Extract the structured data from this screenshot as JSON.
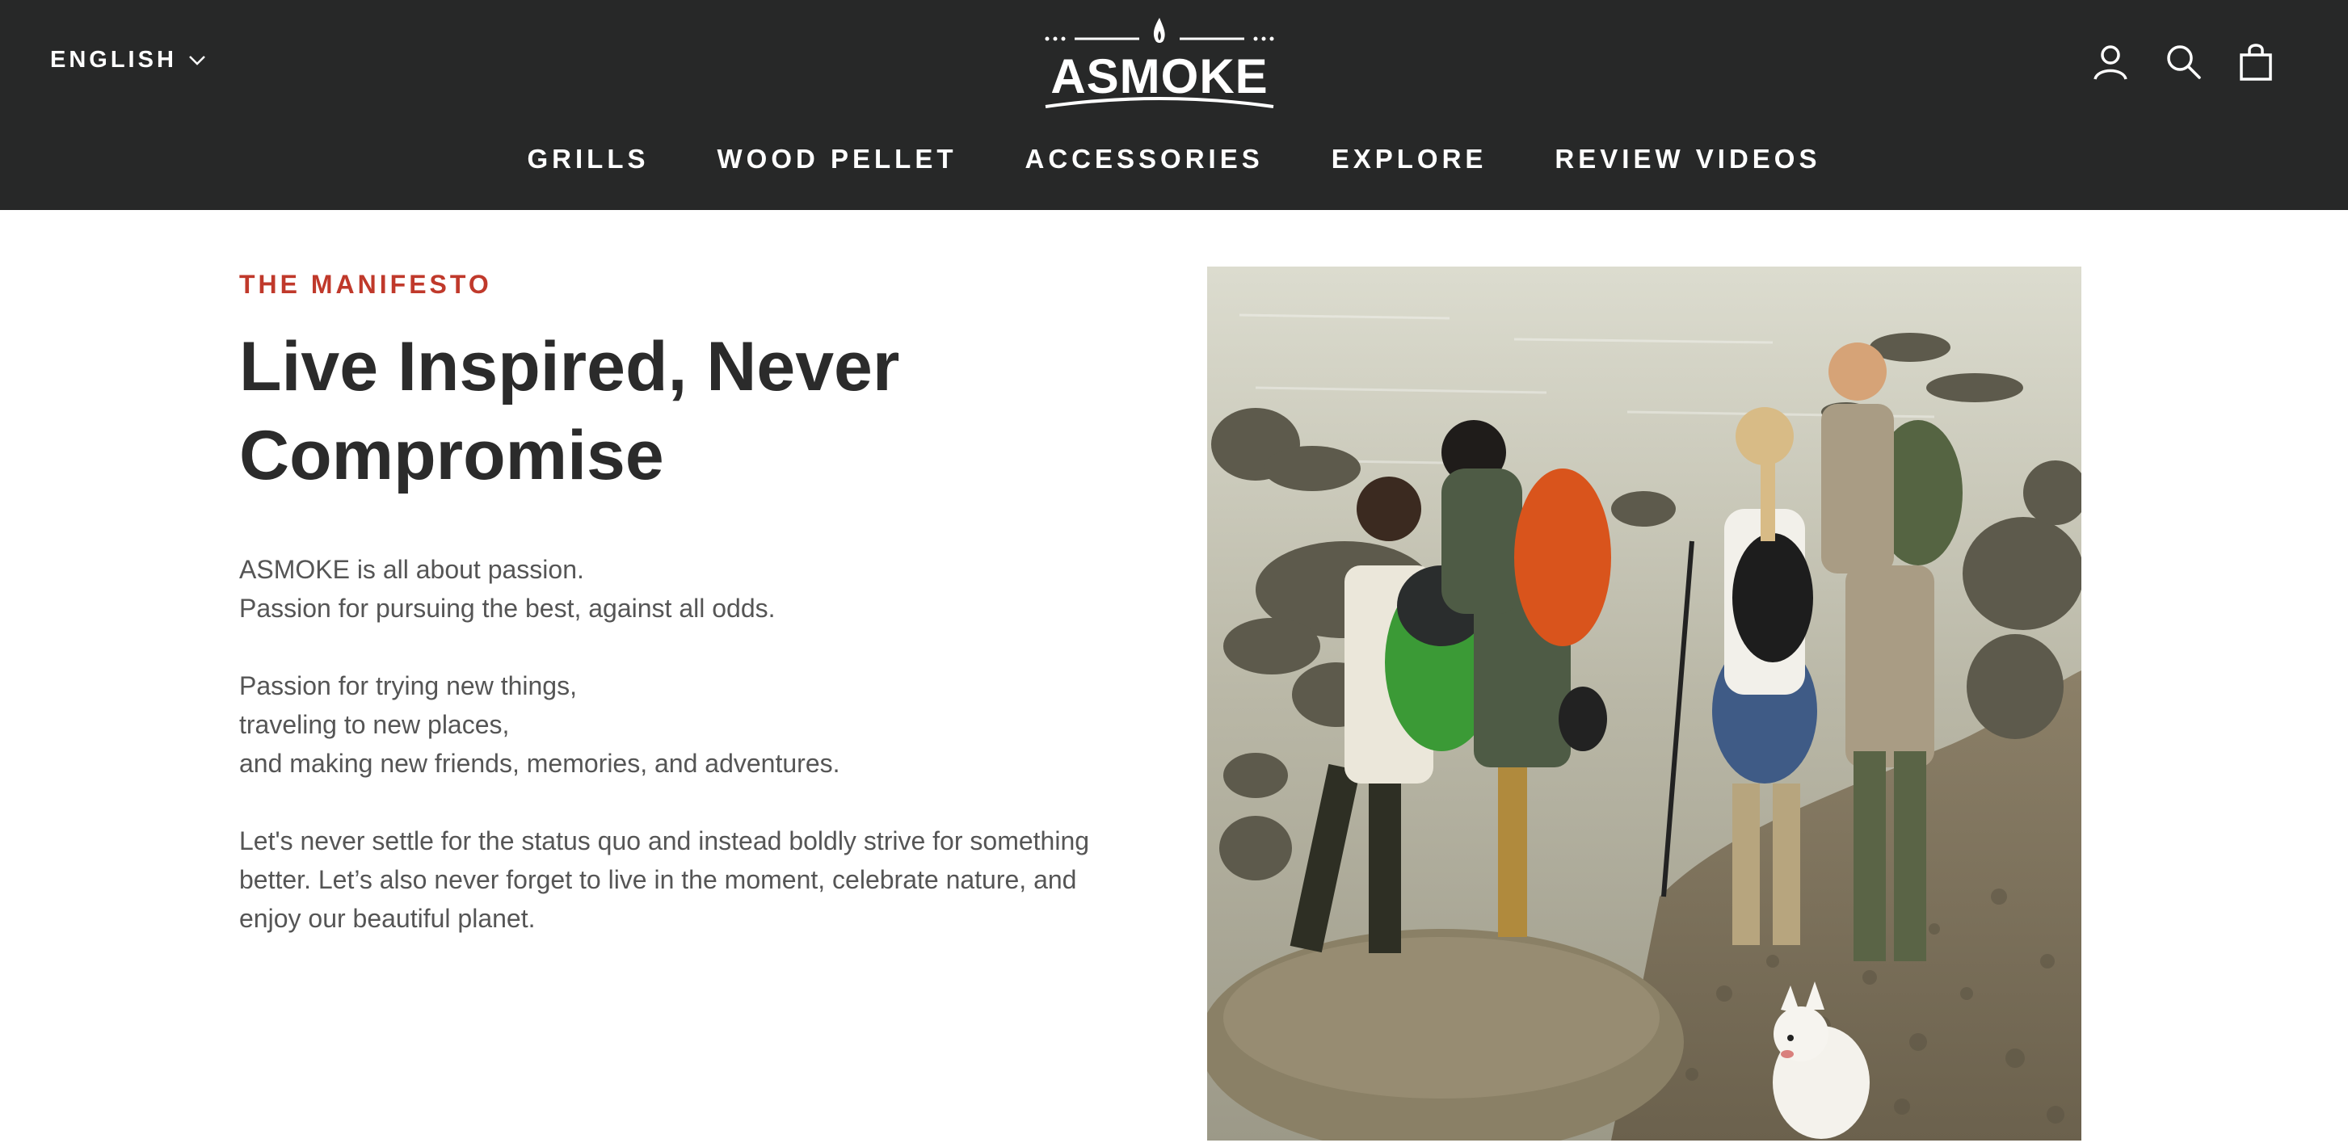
{
  "header": {
    "language": "ENGLISH",
    "logo_text": "ASMOKE",
    "icons": [
      "account-icon",
      "search-icon",
      "cart-icon"
    ],
    "nav": [
      {
        "label": "GRILLS"
      },
      {
        "label": "WOOD PELLET"
      },
      {
        "label": "ACCESSORIES"
      },
      {
        "label": "EXPLORE"
      },
      {
        "label": "REVIEW VIDEOS"
      }
    ]
  },
  "content": {
    "eyebrow": "THE MANIFESTO",
    "headline_line1": "Live Inspired, Never",
    "headline_line2": "Compromise",
    "para1_line1": "ASMOKE is all about passion.",
    "para1_line2": "Passion for pursuing the best, against all odds.",
    "para2_line1": "Passion for trying new things,",
    "para2_line2": "traveling to new places,",
    "para2_line3": "and making new friends, memories, and adventures.",
    "para3_line1": "Let's never settle for the status quo and instead boldly strive for something",
    "para3_line2": "better. Let’s also never forget to live in the moment, celebrate nature, and",
    "para3_line3": "enjoy our beautiful planet."
  },
  "colors": {
    "header_bg": "#272828",
    "accent": "#c0392b",
    "headline": "#2b2b2b",
    "body_text": "#555555"
  }
}
